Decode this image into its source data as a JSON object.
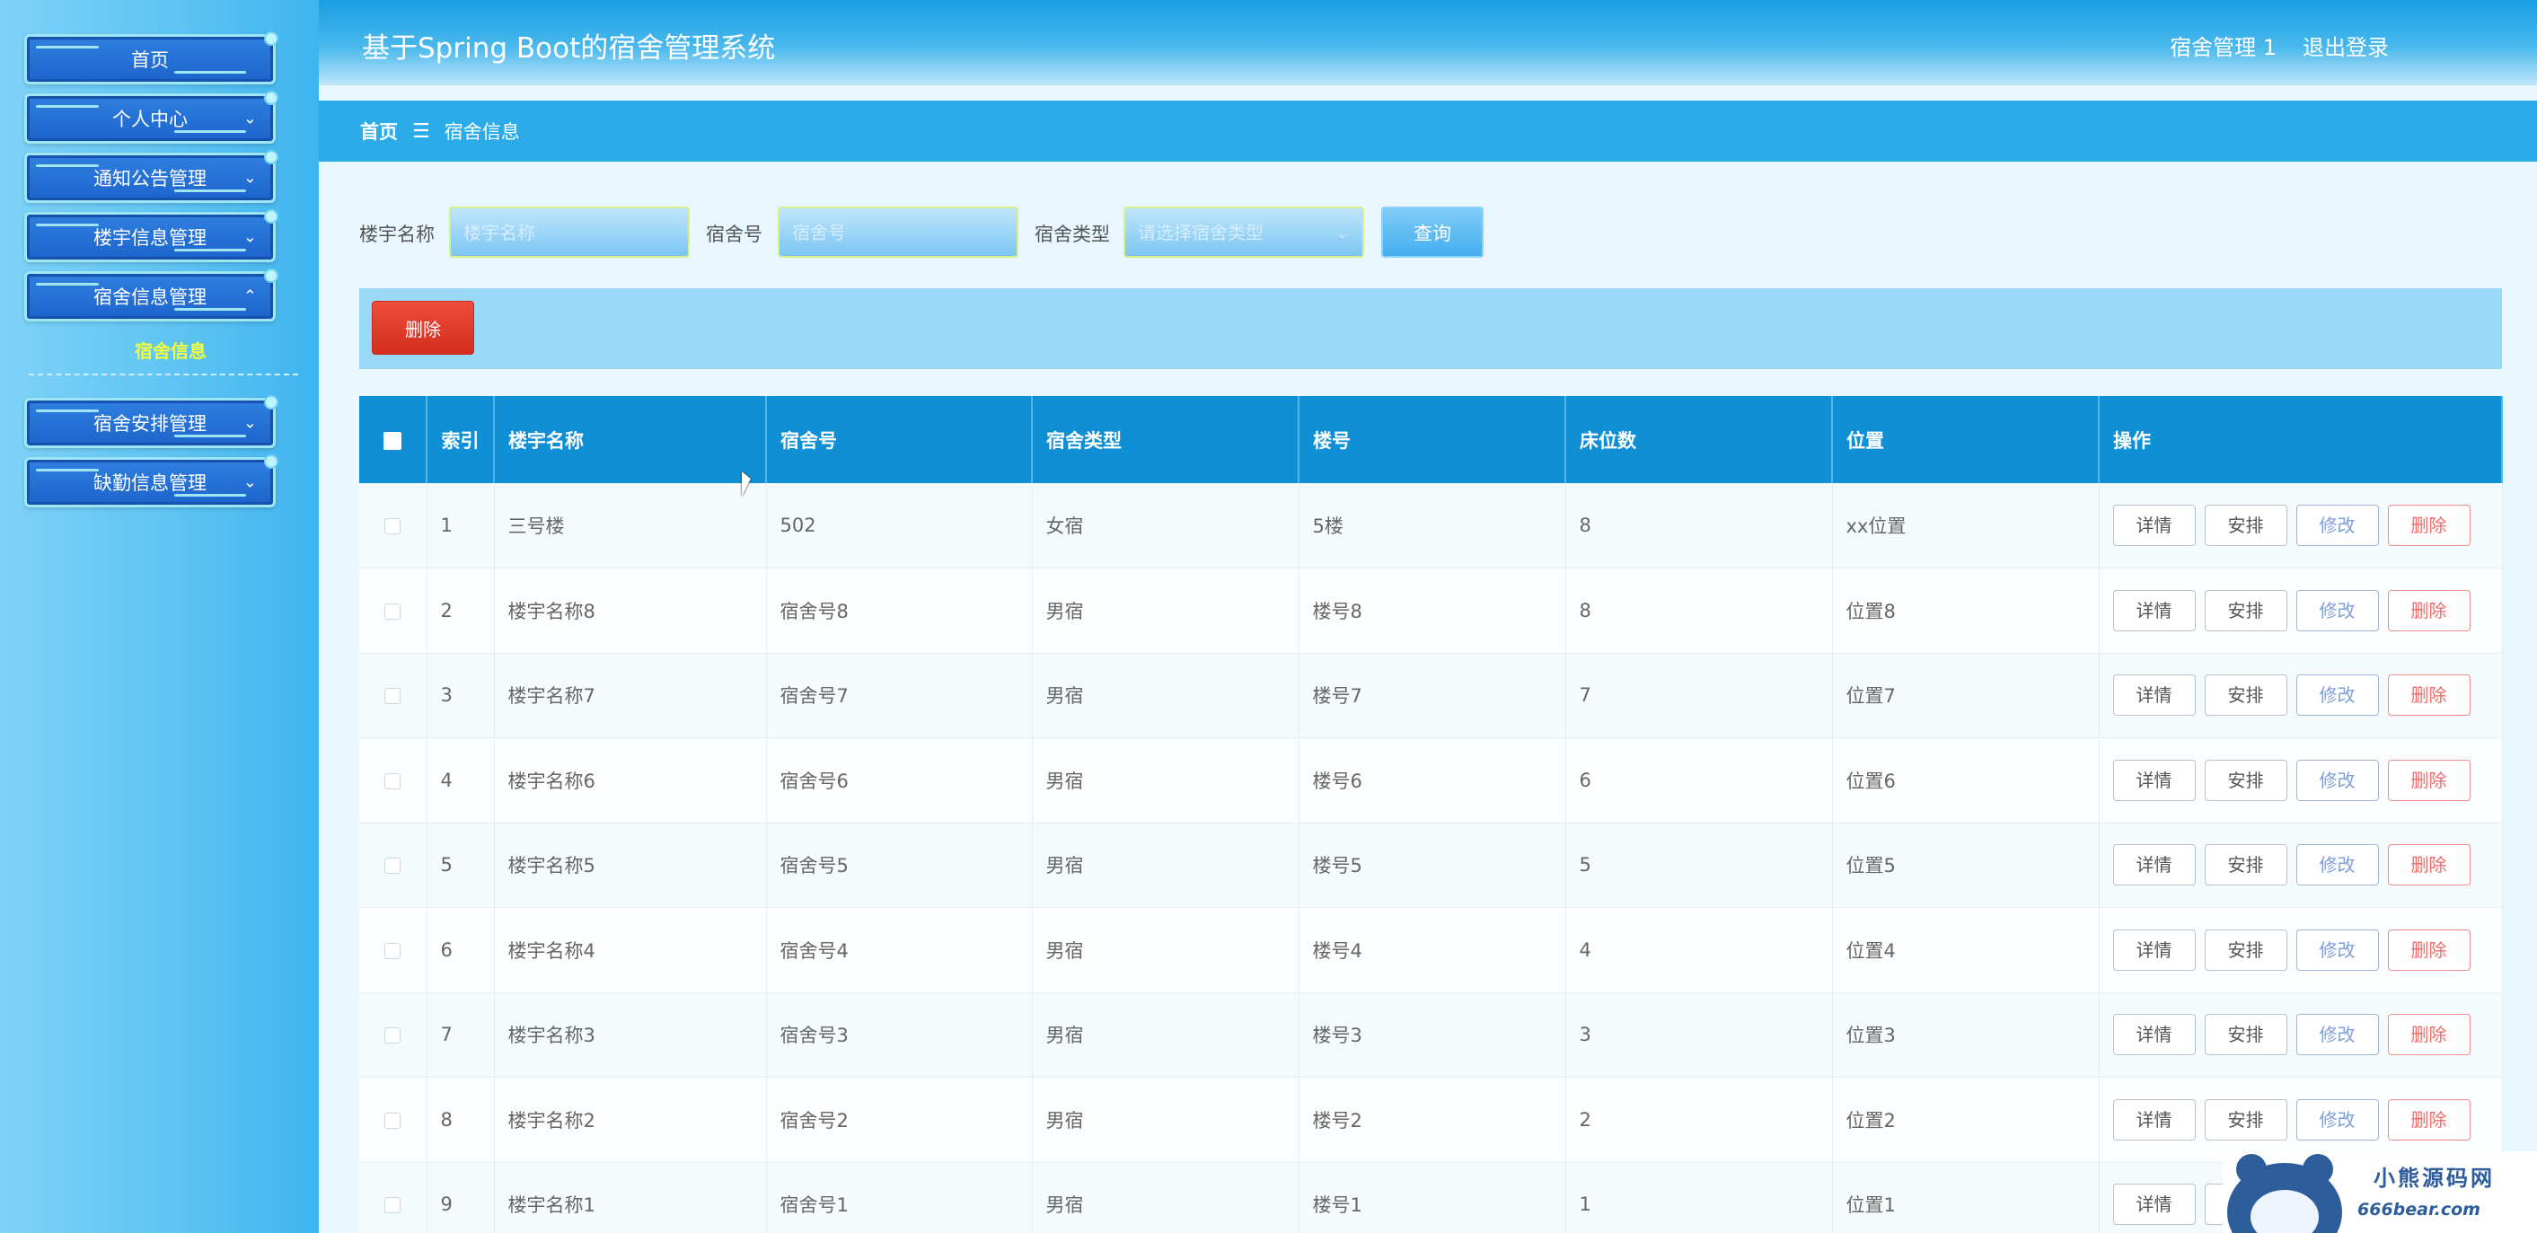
{
  "sidebar": {
    "menu": [
      {
        "label": "首页"
      },
      {
        "label": "个人中心"
      },
      {
        "label": "通知公告管理"
      },
      {
        "label": "楼宇信息管理"
      },
      {
        "label": "宿舍信息管理"
      },
      {
        "label": "宿舍安排管理"
      },
      {
        "label": "缺勤信息管理"
      }
    ],
    "sub_item": "宿舍信息"
  },
  "header": {
    "title": "基于Spring Boot的宿舍管理系统",
    "user": "宿舍管理 1",
    "logout": "退出登录"
  },
  "breadcrumb": {
    "home": "首页",
    "separator": "☰",
    "current": "宿舍信息"
  },
  "search": {
    "building_label": "楼宇名称",
    "building_placeholder": "楼宇名称",
    "room_label": "宿舍号",
    "room_placeholder": "宿舍号",
    "type_label": "宿舍类型",
    "type_placeholder": "请选择宿舍类型",
    "query_button": "查询"
  },
  "actions": {
    "delete_button": "删除"
  },
  "table": {
    "headers": {
      "index": "索引",
      "building": "楼宇名称",
      "room": "宿舍号",
      "type": "宿舍类型",
      "floor": "楼号",
      "beds": "床位数",
      "location": "位置",
      "ops": "操作"
    },
    "op_labels": {
      "detail": "详情",
      "arrange": "安排",
      "edit": "修改",
      "delete": "删除"
    },
    "rows": [
      {
        "index": "1",
        "building": "三号楼",
        "room": "502",
        "type": "女宿",
        "floor": "5楼",
        "beds": "8",
        "location": "xx位置"
      },
      {
        "index": "2",
        "building": "楼宇名称8",
        "room": "宿舍号8",
        "type": "男宿",
        "floor": "楼号8",
        "beds": "8",
        "location": "位置8"
      },
      {
        "index": "3",
        "building": "楼宇名称7",
        "room": "宿舍号7",
        "type": "男宿",
        "floor": "楼号7",
        "beds": "7",
        "location": "位置7"
      },
      {
        "index": "4",
        "building": "楼宇名称6",
        "room": "宿舍号6",
        "type": "男宿",
        "floor": "楼号6",
        "beds": "6",
        "location": "位置6"
      },
      {
        "index": "5",
        "building": "楼宇名称5",
        "room": "宿舍号5",
        "type": "男宿",
        "floor": "楼号5",
        "beds": "5",
        "location": "位置5"
      },
      {
        "index": "6",
        "building": "楼宇名称4",
        "room": "宿舍号4",
        "type": "男宿",
        "floor": "楼号4",
        "beds": "4",
        "location": "位置4"
      },
      {
        "index": "7",
        "building": "楼宇名称3",
        "room": "宿舍号3",
        "type": "男宿",
        "floor": "楼号3",
        "beds": "3",
        "location": "位置3"
      },
      {
        "index": "8",
        "building": "楼宇名称2",
        "room": "宿舍号2",
        "type": "男宿",
        "floor": "楼号2",
        "beds": "2",
        "location": "位置2"
      },
      {
        "index": "9",
        "building": "楼宇名称1",
        "room": "宿舍号1",
        "type": "男宿",
        "floor": "楼号1",
        "beds": "1",
        "location": "位置1"
      }
    ]
  },
  "watermark": {
    "title": "小熊源码网",
    "url": "666bear.com"
  },
  "colors": {
    "header": "#1a9ee3",
    "breadcrumb": "#2bace9",
    "table_header": "#0f8fd6",
    "delete": "#d22d1f",
    "sub_item": "#f0ff3a"
  }
}
